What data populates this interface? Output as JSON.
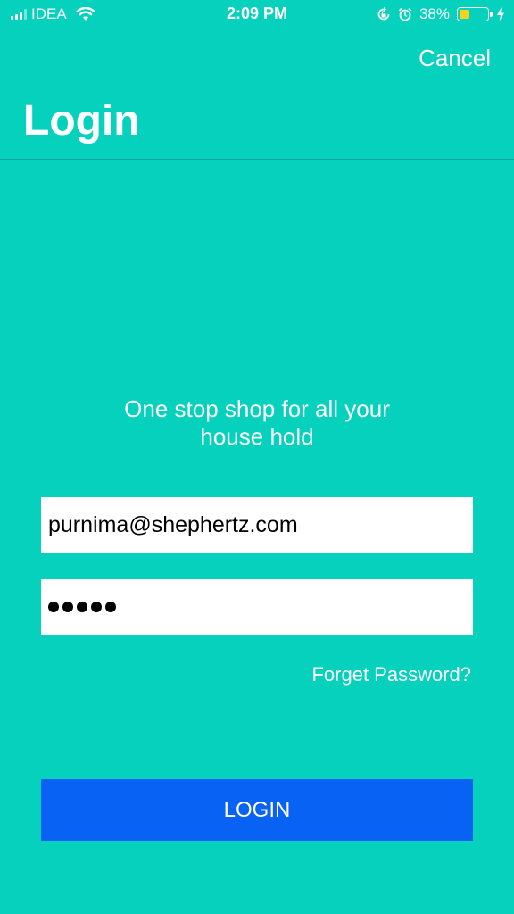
{
  "status_bar": {
    "carrier": "IDEA",
    "time": "2:09 PM",
    "battery_percent": "38%",
    "battery_level": 0.38,
    "icons": [
      "signal-icon",
      "wifi-icon",
      "rotation-lock-icon",
      "alarm-icon",
      "battery-icon",
      "charging-icon"
    ]
  },
  "header": {
    "cancel_label": "Cancel",
    "title": "Login"
  },
  "tagline": {
    "line1": "One stop shop for all your",
    "line2": "house hold"
  },
  "form": {
    "email_value": "purnima@shephertz.com",
    "password_masked_length": 5,
    "forgot_label": "Forget Password?",
    "login_label": "LOGIN"
  },
  "colors": {
    "background": "#05d1bd",
    "login_button": "#0863f5",
    "battery_fill": "#f7d21a"
  }
}
